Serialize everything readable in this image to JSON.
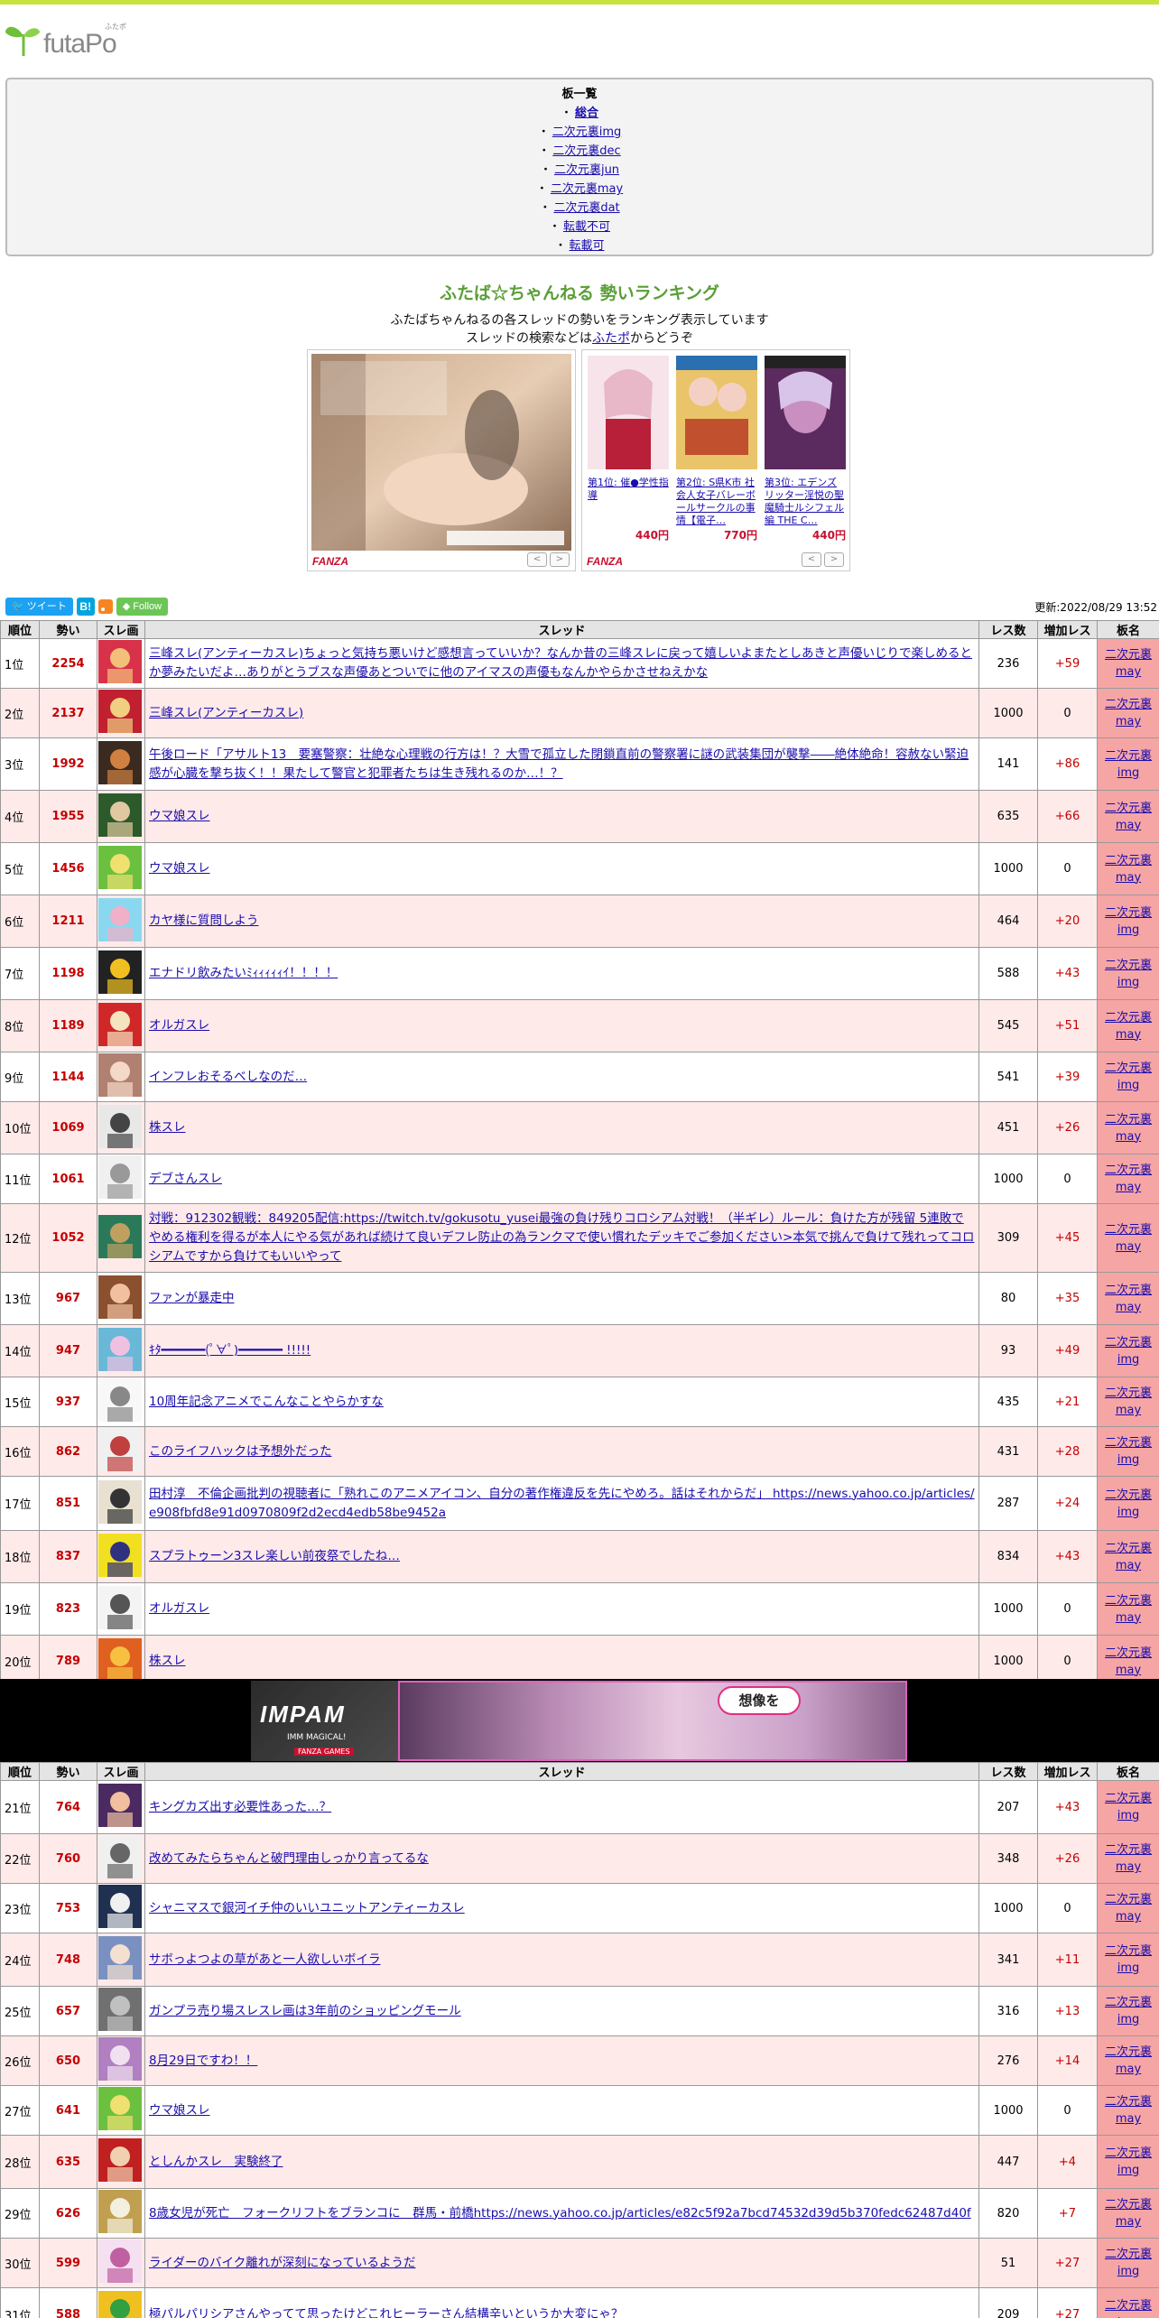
{
  "logo": {
    "word": "futaPo",
    "ruby": "ふたポ"
  },
  "boards": {
    "title": "板一覧",
    "items": [
      {
        "label": "総合",
        "current": true
      },
      {
        "label": "二次元裏img"
      },
      {
        "label": "二次元裏dec"
      },
      {
        "label": "二次元裏jun"
      },
      {
        "label": "二次元裏may"
      },
      {
        "label": "二次元裏dat"
      },
      {
        "label": "転載不可"
      },
      {
        "label": "転載可"
      }
    ],
    "bullet": "・"
  },
  "ranking": {
    "title": "ふたば☆ちゃんねる 勢いランキング",
    "desc1": "ふたばちゃんねるの各スレッドの勢いをランキング表示しています",
    "desc2_pre": "スレッドの検索などは",
    "desc2_link": "ふたポ",
    "desc2_post": "からどうぞ"
  },
  "ads": {
    "brand": "FANZA",
    "products": [
      {
        "title": "第1位: 催●学性指導",
        "price": "440円"
      },
      {
        "title": "第2位: S県K市 社会人女子バレーボールサークルの事情【電子…",
        "price": "770円"
      },
      {
        "title": "第3位: エデンズリッター淫悦の聖魔騎士ルシフェル編 THE C…",
        "price": "440円"
      }
    ],
    "prev": "<",
    "next": ">"
  },
  "social": {
    "tweet": "ツイート",
    "hatena": "B!",
    "follow": "Follow"
  },
  "updated": "更新:2022/08/29 13:52",
  "table": {
    "headers": [
      "順位",
      "勢い",
      "スレ画",
      "スレッド",
      "レス数",
      "増加レス",
      "板名"
    ]
  },
  "rows1": [
    {
      "pos": "1位",
      "ikioi": "2254",
      "thread": "三峰スレ(アンティーカスレ)ちょっと気持ち悪いけど感想言っていいか？なんか昔の三峰スレに戻って嬉しいよまたとしあきと声優いじりで楽しめるとか夢みたいだよ…ありがとうブスな声優あとついでに他のアイマスの声優もなんかやらかさせねえかな",
      "res": "236",
      "add": "+59",
      "board1": "二次元裏",
      "board2": "may"
    },
    {
      "pos": "2位",
      "ikioi": "2137",
      "thread": "三峰スレ(アンティーカスレ)",
      "res": "1000",
      "add": "0",
      "board1": "二次元裏",
      "board2": "may"
    },
    {
      "pos": "3位",
      "ikioi": "1992",
      "thread": "午後ロード「アサルト13　要塞警察：壮絶な心理戦の行方は！？大雪で孤立した閉鎖直前の警察署に謎の武装集団が襲撃――絶体絶命！容赦ない緊迫感が心臓を撃ち抜く！！果たして警官と犯罪者たちは生き残れるのか…！？",
      "res": "141",
      "add": "+86",
      "board1": "二次元裏",
      "board2": "img"
    },
    {
      "pos": "4位",
      "ikioi": "1955",
      "thread": "ウマ娘スレ",
      "res": "635",
      "add": "+66",
      "board1": "二次元裏",
      "board2": "may"
    },
    {
      "pos": "5位",
      "ikioi": "1456",
      "thread": "ウマ娘スレ",
      "res": "1000",
      "add": "0",
      "board1": "二次元裏",
      "board2": "may"
    },
    {
      "pos": "6位",
      "ikioi": "1211",
      "thread": "カヤ様に質問しよう",
      "res": "464",
      "add": "+20",
      "board1": "二次元裏",
      "board2": "img"
    },
    {
      "pos": "7位",
      "ikioi": "1198",
      "thread": "エナドリ飲みたいﾐｨｨｨｨｨｲ！！！！",
      "res": "588",
      "add": "+43",
      "board1": "二次元裏",
      "board2": "img"
    },
    {
      "pos": "8位",
      "ikioi": "1189",
      "thread": "オルガスレ",
      "res": "545",
      "add": "+51",
      "board1": "二次元裏",
      "board2": "may"
    },
    {
      "pos": "9位",
      "ikioi": "1144",
      "thread": "インフレおそるべしなのだ…",
      "res": "541",
      "add": "+39",
      "board1": "二次元裏",
      "board2": "img"
    },
    {
      "pos": "10位",
      "ikioi": "1069",
      "thread": "株スレ",
      "res": "451",
      "add": "+26",
      "board1": "二次元裏",
      "board2": "may"
    },
    {
      "pos": "11位",
      "ikioi": "1061",
      "thread": "デブさんスレ",
      "res": "1000",
      "add": "0",
      "board1": "二次元裏",
      "board2": "may"
    },
    {
      "pos": "12位",
      "ikioi": "1052",
      "thread": "対戦：912302観戦：849205配信:https://twitch.tv/gokusotu_yusei最強の負け残りコロシアム対戦！（半ギレ）ルール：負けた方が残留 5連敗でやめる権利を得るが本人にやる気があれば続けて良いデフレ防止の為ランクマで使い慣れたデッキでご参加ください>本気で挑んで負けて残れってコロシアムですから負けてもいいやって",
      "res": "309",
      "add": "+45",
      "board1": "二次元裏",
      "board2": "may"
    },
    {
      "pos": "13位",
      "ikioi": "967",
      "thread": "ファンが暴走中",
      "res": "80",
      "add": "+35",
      "board1": "二次元裏",
      "board2": "may"
    },
    {
      "pos": "14位",
      "ikioi": "947",
      "thread": "ｷﾀ━━━━━━(ﾟ∀ﾟ)━━━━━━ !!!!!",
      "res": "93",
      "add": "+49",
      "board1": "二次元裏",
      "board2": "img"
    },
    {
      "pos": "15位",
      "ikioi": "937",
      "thread": "10周年記念アニメでこんなことやらかすな",
      "res": "435",
      "add": "+21",
      "board1": "二次元裏",
      "board2": "may"
    },
    {
      "pos": "16位",
      "ikioi": "862",
      "thread": "このライフハックは予想外だった",
      "res": "431",
      "add": "+28",
      "board1": "二次元裏",
      "board2": "img"
    },
    {
      "pos": "17位",
      "ikioi": "851",
      "thread": "田村淳　不倫企画批判の視聴者に「熟れこのアニメアイコン、自分の著作権違反を先にやめろ。話はそれからだ」 https://news.yahoo.co.jp/articles/e908fbfd8e91d0970809f2d2ecd4edb58be9452a",
      "res": "287",
      "add": "+24",
      "board1": "二次元裏",
      "board2": "img"
    },
    {
      "pos": "18位",
      "ikioi": "837",
      "thread": "スプラトゥーン3スレ楽しい前夜祭でしたね…",
      "res": "834",
      "add": "+43",
      "board1": "二次元裏",
      "board2": "may"
    },
    {
      "pos": "19位",
      "ikioi": "823",
      "thread": "オルガスレ",
      "res": "1000",
      "add": "0",
      "board1": "二次元裏",
      "board2": "may"
    },
    {
      "pos": "20位",
      "ikioi": "789",
      "thread": "株スレ",
      "res": "1000",
      "add": "0",
      "board1": "二次元裏",
      "board2": "may"
    }
  ],
  "banner": {
    "title": "IMPAM",
    "sub": "IMM MAGICAL!",
    "tag": "FANZA GAMES",
    "bubble": "想像を"
  },
  "rows2": [
    {
      "pos": "21位",
      "ikioi": "764",
      "thread": "キングカズ出す必要性あった…？",
      "res": "207",
      "add": "+43",
      "board1": "二次元裏",
      "board2": "img"
    },
    {
      "pos": "22位",
      "ikioi": "760",
      "thread": "改めてみたらちゃんと破門理由しっかり言ってるな",
      "res": "348",
      "add": "+26",
      "board1": "二次元裏",
      "board2": "may"
    },
    {
      "pos": "23位",
      "ikioi": "753",
      "thread": "シャニマスで銀河イチ仲のいいユニットアンティーカスレ",
      "res": "1000",
      "add": "0",
      "board1": "二次元裏",
      "board2": "may"
    },
    {
      "pos": "24位",
      "ikioi": "748",
      "thread": "サボっよつよの草があと一人欲しいボイラ",
      "res": "341",
      "add": "+11",
      "board1": "二次元裏",
      "board2": "img"
    },
    {
      "pos": "25位",
      "ikioi": "657",
      "thread": "ガンプラ売り場スレスレ画は3年前のショッピングモール",
      "res": "316",
      "add": "+13",
      "board1": "二次元裏",
      "board2": "img"
    },
    {
      "pos": "26位",
      "ikioi": "650",
      "thread": "8月29日ですわ！！",
      "res": "276",
      "add": "+14",
      "board1": "二次元裏",
      "board2": "may"
    },
    {
      "pos": "27位",
      "ikioi": "641",
      "thread": "ウマ娘スレ",
      "res": "1000",
      "add": "0",
      "board1": "二次元裏",
      "board2": "may"
    },
    {
      "pos": "28位",
      "ikioi": "635",
      "thread": "としんかスレ　実験終了",
      "res": "447",
      "add": "+4",
      "board1": "二次元裏",
      "board2": "img"
    },
    {
      "pos": "29位",
      "ikioi": "626",
      "thread": "8歳女児が死亡　フォークリフトをブランコに　群馬・前橋https://news.yahoo.co.jp/articles/e82c5f92a7bcd74532d39d5b370fedc62487d40f",
      "res": "820",
      "add": "+7",
      "board1": "二次元裏",
      "board2": "may"
    },
    {
      "pos": "30位",
      "ikioi": "599",
      "thread": "ライダーのバイク離れが深刻になっているようだ",
      "res": "51",
      "add": "+27",
      "board1": "二次元裏",
      "board2": "img"
    },
    {
      "pos": "31位",
      "ikioi": "588",
      "thread": "極パルパリシアさんやってて思ったけどこれヒーラーさん結構辛いというか大変にゃ？",
      "res": "209",
      "add": "+27",
      "board1": "二次元裏",
      "board2": "img"
    }
  ]
}
